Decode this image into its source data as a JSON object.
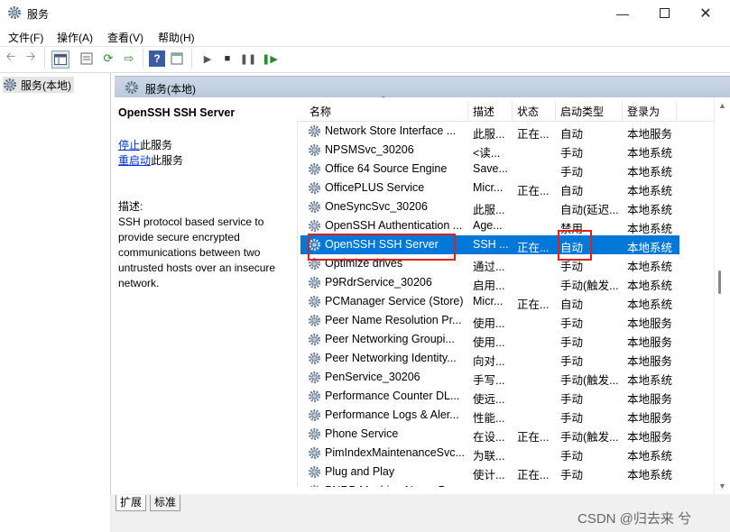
{
  "window": {
    "title": "服务",
    "min_icon": "minimize-icon",
    "max_icon": "maximize-icon",
    "close_icon": "close-icon"
  },
  "menu": [
    "文件(F)",
    "操作(A)",
    "查看(V)",
    "帮助(H)"
  ],
  "tree": {
    "root_label": "服务(本地)"
  },
  "right_header": "服务(本地)",
  "detail": {
    "service_name": "OpenSSH SSH Server",
    "stop_link": "停止",
    "stop_suffix": "此服务",
    "restart_link": "重启动",
    "restart_suffix": "此服务",
    "desc_label": "描述:",
    "desc_lines": [
      "SSH protocol based service to",
      "provide secure encrypted",
      "communications between two",
      "untrusted hosts over an insecure",
      "network."
    ]
  },
  "columns": [
    "名称",
    "描述",
    "状态",
    "启动类型",
    "登录为"
  ],
  "rows": [
    [
      "Network Store Interface ...",
      "此服...",
      "正在...",
      "自动",
      "本地服务"
    ],
    [
      "NPSMSvc_30206",
      "<读...",
      "",
      "手动",
      "本地系统"
    ],
    [
      "Office 64 Source Engine",
      "Save...",
      "",
      "手动",
      "本地系统"
    ],
    [
      "OfficePLUS Service",
      "Micr...",
      "正在...",
      "自动",
      "本地系统"
    ],
    [
      "OneSyncSvc_30206",
      "此服...",
      "",
      "自动(延迟...",
      "本地系统"
    ],
    [
      "OpenSSH Authentication ...",
      "Age...",
      "",
      "禁用",
      "本地系统"
    ],
    [
      "OpenSSH SSH Server",
      "SSH ...",
      "正在...",
      "自动",
      "本地系统"
    ],
    [
      "Optimize drives",
      "通过...",
      "",
      "手动",
      "本地系统"
    ],
    [
      "P9RdrService_30206",
      "启用...",
      "",
      "手动(触发...",
      "本地系统"
    ],
    [
      "PCManager Service (Store)",
      "Micr...",
      "正在...",
      "自动",
      "本地系统"
    ],
    [
      "Peer Name Resolution Pr...",
      "使用...",
      "",
      "手动",
      "本地服务"
    ],
    [
      "Peer Networking Groupi...",
      "使用...",
      "",
      "手动",
      "本地服务"
    ],
    [
      "Peer Networking Identity...",
      "向对...",
      "",
      "手动",
      "本地服务"
    ],
    [
      "PenService_30206",
      "手写...",
      "",
      "手动(触发...",
      "本地系统"
    ],
    [
      "Performance Counter DL...",
      "使远...",
      "",
      "手动",
      "本地服务"
    ],
    [
      "Performance Logs & Aler...",
      "性能...",
      "",
      "手动",
      "本地服务"
    ],
    [
      "Phone Service",
      "在设...",
      "正在...",
      "手动(触发...",
      "本地服务"
    ],
    [
      "PimIndexMaintenanceSvc...",
      "为联...",
      "",
      "手动",
      "本地系统"
    ],
    [
      "Plug and Play",
      "使计...",
      "正在...",
      "手动",
      "本地系统"
    ],
    [
      "PNRP Machine Name Pu...",
      "此服...",
      "",
      "手动",
      "本地服务"
    ]
  ],
  "selected_index": 6,
  "tabs": [
    "扩展",
    "标准"
  ],
  "watermark": "CSDN @归去来 兮",
  "colors": {
    "selection": "#0078d7",
    "highlight_box": "#e02020",
    "link": "#0033cc"
  }
}
